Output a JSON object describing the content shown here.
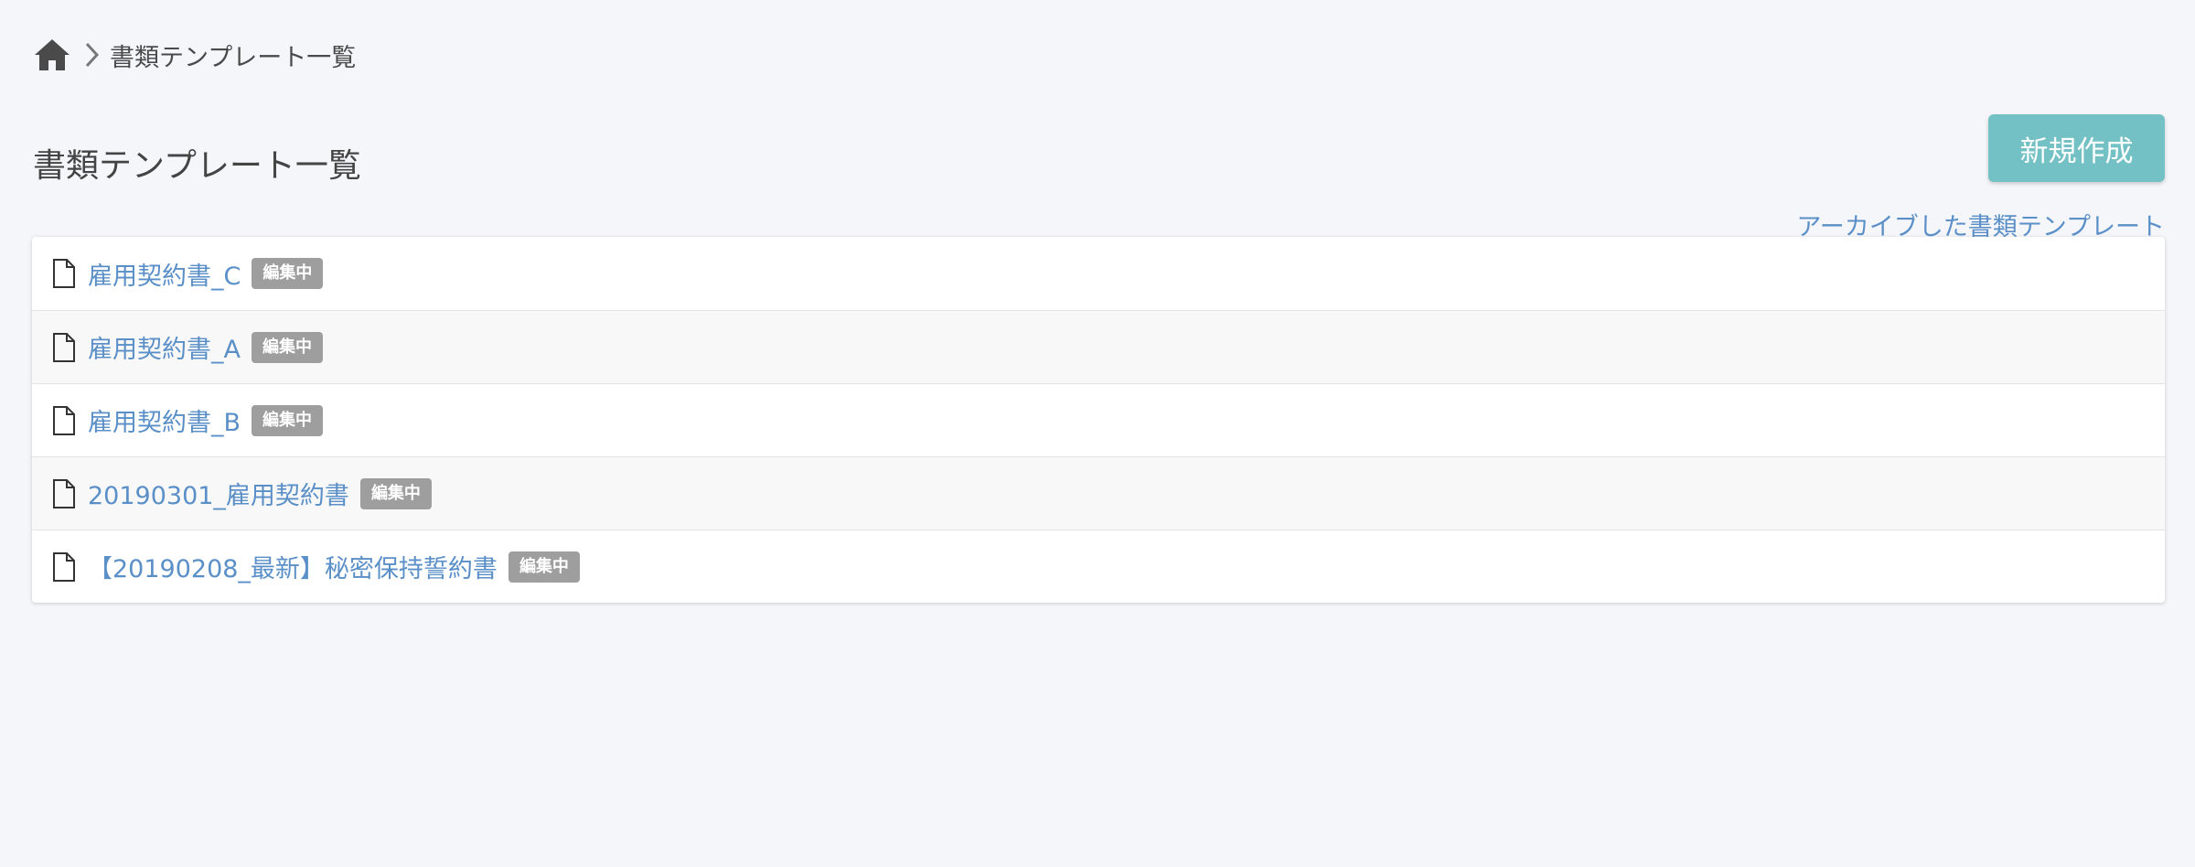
{
  "breadcrumb": {
    "home_icon": "home-icon",
    "separator_icon": "chevron-right-icon",
    "current": "書類テンプレート一覧"
  },
  "header": {
    "title": "書類テンプレート一覧",
    "new_button_label": "新規作成",
    "archive_link_label": "アーカイブした書類テンプレート"
  },
  "templates": [
    {
      "name": "雇用契約書_C",
      "status": "編集中",
      "icon": "document-icon"
    },
    {
      "name": "雇用契約書_A",
      "status": "編集中",
      "icon": "document-icon"
    },
    {
      "name": "雇用契約書_B",
      "status": "編集中",
      "icon": "document-icon"
    },
    {
      "name": "20190301_雇用契約書",
      "status": "編集中",
      "icon": "document-icon"
    },
    {
      "name": "【20190208_最新】秘密保持誓約書",
      "status": "編集中",
      "icon": "document-icon"
    }
  ],
  "colors": {
    "background": "#f5f6fa",
    "accent_button": "#73c1c4",
    "link": "#5a8fc7",
    "badge": "#9e9e9e"
  }
}
